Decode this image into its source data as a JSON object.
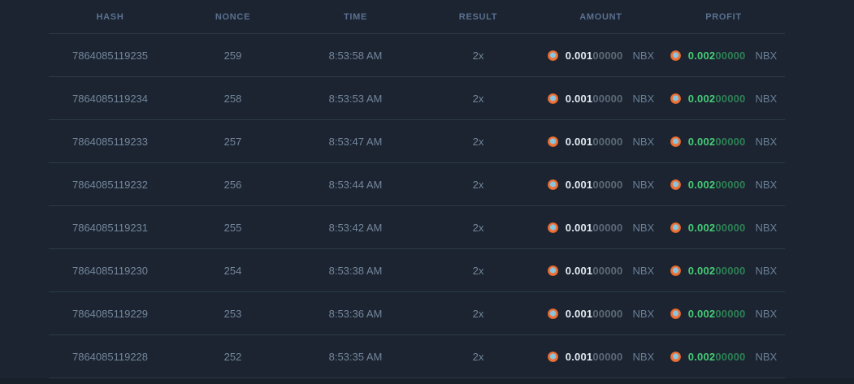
{
  "table": {
    "columns": [
      "HASH",
      "NONCE",
      "TIME",
      "RESULT",
      "AMOUNT",
      "PROFIT"
    ],
    "rows": [
      {
        "hash": "7864085119235",
        "nonce": "259",
        "time": "8:53:58 AM",
        "result": "2x",
        "amount": {
          "main": "0.001",
          "trail": "00000",
          "currency": "NBX"
        },
        "profit": {
          "main": "0.002",
          "trail": "00000",
          "currency": "NBX"
        }
      },
      {
        "hash": "7864085119234",
        "nonce": "258",
        "time": "8:53:53 AM",
        "result": "2x",
        "amount": {
          "main": "0.001",
          "trail": "00000",
          "currency": "NBX"
        },
        "profit": {
          "main": "0.002",
          "trail": "00000",
          "currency": "NBX"
        }
      },
      {
        "hash": "7864085119233",
        "nonce": "257",
        "time": "8:53:47 AM",
        "result": "2x",
        "amount": {
          "main": "0.001",
          "trail": "00000",
          "currency": "NBX"
        },
        "profit": {
          "main": "0.002",
          "trail": "00000",
          "currency": "NBX"
        }
      },
      {
        "hash": "7864085119232",
        "nonce": "256",
        "time": "8:53:44 AM",
        "result": "2x",
        "amount": {
          "main": "0.001",
          "trail": "00000",
          "currency": "NBX"
        },
        "profit": {
          "main": "0.002",
          "trail": "00000",
          "currency": "NBX"
        }
      },
      {
        "hash": "7864085119231",
        "nonce": "255",
        "time": "8:53:42 AM",
        "result": "2x",
        "amount": {
          "main": "0.001",
          "trail": "00000",
          "currency": "NBX"
        },
        "profit": {
          "main": "0.002",
          "trail": "00000",
          "currency": "NBX"
        }
      },
      {
        "hash": "7864085119230",
        "nonce": "254",
        "time": "8:53:38 AM",
        "result": "2x",
        "amount": {
          "main": "0.001",
          "trail": "00000",
          "currency": "NBX"
        },
        "profit": {
          "main": "0.002",
          "trail": "00000",
          "currency": "NBX"
        }
      },
      {
        "hash": "7864085119229",
        "nonce": "253",
        "time": "8:53:36 AM",
        "result": "2x",
        "amount": {
          "main": "0.001",
          "trail": "00000",
          "currency": "NBX"
        },
        "profit": {
          "main": "0.002",
          "trail": "00000",
          "currency": "NBX"
        }
      },
      {
        "hash": "7864085119228",
        "nonce": "252",
        "time": "8:53:35 AM",
        "result": "2x",
        "amount": {
          "main": "0.001",
          "trail": "00000",
          "currency": "NBX"
        },
        "profit": {
          "main": "0.002",
          "trail": "00000",
          "currency": "NBX"
        }
      }
    ]
  },
  "icons": {
    "coin": "nbx-coin-icon"
  },
  "colors": {
    "background": "#1b2430",
    "bottom_strip": "#18202a",
    "divider": "#2e3b49",
    "header_text": "#5b7190",
    "row_text": "#74869c",
    "amount_main": "#e3eaf2",
    "amount_trailing": "#5d6a79",
    "profit_main": "#47cc77",
    "profit_trailing": "#2e8056",
    "coin_orange": "#ee7035",
    "coin_center_blue": "#8ac5df"
  }
}
